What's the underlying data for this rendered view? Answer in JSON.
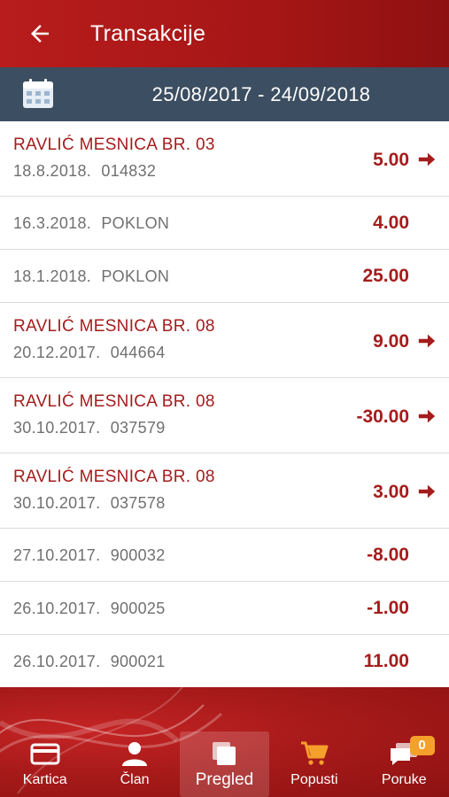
{
  "header": {
    "title": "Transakcije"
  },
  "date_bar": {
    "range": "25/08/2017 - 24/09/2018"
  },
  "transactions": [
    {
      "merchant": "RAVLIĆ MESNICA BR. 03",
      "meta": "18.8.2018. 014832",
      "amount": "5.00"
    },
    {
      "meta": "16.3.2018. POKLON",
      "amount": "4.00"
    },
    {
      "meta": "18.1.2018. POKLON",
      "amount": "25.00"
    },
    {
      "merchant": "RAVLIĆ MESNICA BR. 08",
      "meta": "20.12.2017. 044664",
      "amount": "9.00"
    },
    {
      "merchant": "RAVLIĆ MESNICA BR. 08",
      "meta": "30.10.2017. 037579",
      "amount": "-30.00"
    },
    {
      "merchant": "RAVLIĆ MESNICA BR. 08",
      "meta": "30.10.2017. 037578",
      "amount": "3.00"
    },
    {
      "meta": "27.10.2017. 900032",
      "amount": "-8.00"
    },
    {
      "meta": "26.10.2017. 900025",
      "amount": "-1.00"
    },
    {
      "meta": "26.10.2017. 900021",
      "amount": "11.00"
    }
  ],
  "tabs": [
    {
      "label": "Kartica",
      "icon": "card-icon"
    },
    {
      "label": "Član",
      "icon": "person-icon"
    },
    {
      "label": "Pregled",
      "icon": "overview-icon",
      "active": true
    },
    {
      "label": "Popusti",
      "icon": "cart-icon"
    },
    {
      "label": "Poruke",
      "icon": "messages-icon",
      "badge": "0"
    }
  ],
  "colors": {
    "brand_red": "#a51c1c",
    "date_bar": "#3c4e61",
    "accent_orange": "#f5a02a"
  }
}
